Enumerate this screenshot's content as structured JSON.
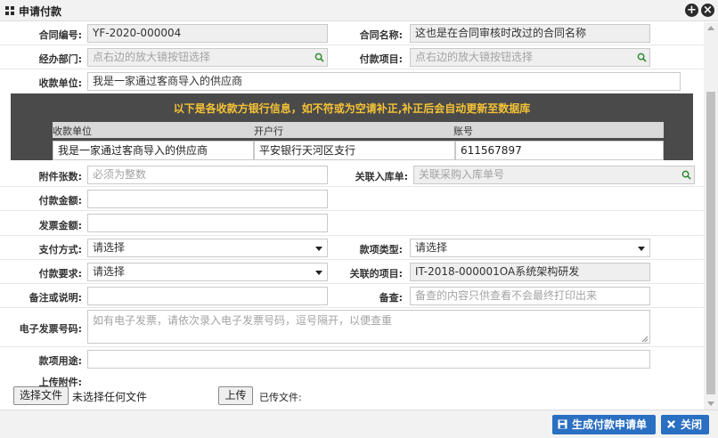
{
  "window": {
    "title": "申请付款",
    "add_btn": "+",
    "close_btn": "×"
  },
  "form": {
    "contract_no": {
      "label": "合同编号:",
      "value": "YF-2020-000004"
    },
    "contract_name": {
      "label": "合同名称:",
      "value": "这也是在合同审核时改过的合同名称"
    },
    "department": {
      "label": "经办部门:",
      "placeholder": "点右边的放大镜按钮选择"
    },
    "project": {
      "label": "付款项目:",
      "placeholder": "点右边的放大镜按钮选择"
    },
    "payee": {
      "label": "收款单位:",
      "value": "我是一家通过客商导入的供应商"
    },
    "bank": {
      "notice": "以下是各收款方银行信息，如不符或为空请补正,补正后会自动更新至数据库",
      "headers": [
        "收款单位",
        "开户行",
        "账号"
      ],
      "row": [
        "我是一家通过客商导入的供应商",
        "平安银行天河区支行",
        "611567897"
      ]
    },
    "attachments_count": {
      "label": "附件张数:",
      "placeholder": "必须为整数"
    },
    "linked_receipt": {
      "label": "关联入库单:",
      "placeholder": "关联采购入库单号"
    },
    "pay_amount": {
      "label": "付款金额:"
    },
    "invoice_amount": {
      "label": "发票金额:"
    },
    "pay_method": {
      "label": "支付方式:",
      "value": "请选择"
    },
    "fund_type": {
      "label": "款项类型:",
      "value": "请选择"
    },
    "pay_requirement": {
      "label": "付款要求:",
      "value": "请选择"
    },
    "linked_project": {
      "label": "关联的项目:",
      "value": "IT-2018-000001OA系统架构研发"
    },
    "remarks": {
      "label": "备注或说明:"
    },
    "memo": {
      "label": "备查:",
      "placeholder": "备查的内容只供查看不会最终打印出来"
    },
    "e_invoice": {
      "label": "电子发票号码:",
      "placeholder": "如有电子发票，请依次录入电子发票号码，逗号隔开，以便查重"
    },
    "purpose": {
      "label": "款项用途:"
    },
    "upload": {
      "label": "上传附件:",
      "choose_btn": "选择文件",
      "no_file": "未选择任何文件",
      "upload_btn": "上传",
      "uploaded": "已传文件:"
    }
  },
  "footer": {
    "generate_btn": "生成付款申请单",
    "close_btn": "关闭"
  },
  "colors": {
    "accent": "#2a6fc2",
    "notice": "#f5c236",
    "bank_bg": "#4a4a4a",
    "search_icon": "#2e8b2e"
  }
}
